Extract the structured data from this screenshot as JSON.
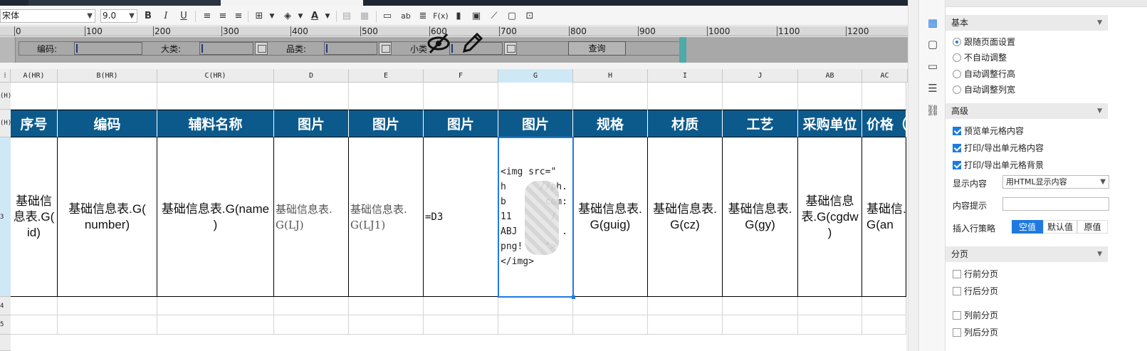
{
  "toolbar": {
    "font_name": "宋体",
    "font_size": "9.0",
    "bold": "B",
    "italic": "I",
    "underline": "U",
    "text_label": "ab",
    "fx_label": "F(x)"
  },
  "ruler": {
    "ticks": [
      "0",
      "100",
      "200",
      "300",
      "400",
      "500",
      "600",
      "700",
      "800",
      "900",
      "1000",
      "1100",
      "1200"
    ]
  },
  "params": {
    "code_label": "编码:",
    "category_label": "大类:",
    "type_label": "品类:",
    "subcategory_label": "小类",
    "query_button": "查询"
  },
  "columns": [
    "A(HR)",
    "B(HR)",
    "C(HR)",
    "D",
    "E",
    "F",
    "G",
    "H",
    "I",
    "J",
    "AB",
    "AC"
  ],
  "rows": [
    "(H)",
    "(H)",
    "3",
    "4",
    "5"
  ],
  "header_row": [
    "序号",
    "编码",
    "辅料名称",
    "图片",
    "图片",
    "图片",
    "图片",
    "规格",
    "材质",
    "工艺",
    "采购单位",
    "价格（"
  ],
  "data_row": {
    "a": "基础信\n息表.G(\nid)",
    "b": "基础信息表.G(\nnumber)",
    "c": "基础信息表.G(name\n)",
    "d": "基础信息表.\nG(LJ)",
    "e": "基础信息表.\nG(LJ1)",
    "f": "=D3",
    "g": "<img src=\"\nh      //ph.\nb       com:\n11       /\nABJ        .\npng!    \">\n</img>",
    "h": "基础信息表.\nG(guig)",
    "i": "基础信息表.\nG(cz)",
    "j": "基础信息表.\nG(gy)",
    "ab": "基础信息\n表.G(cgdw\n)",
    "ac": "基础信.\nG(an"
  },
  "panel": {
    "basic_title": "基本",
    "fit_options": [
      "跟随页面设置",
      "不自动调整",
      "自动调整行高",
      "自动调整列宽"
    ],
    "advanced_title": "高级",
    "adv_options": [
      "预览单元格内容",
      "打印/导出单元格内容",
      "打印/导出单元格背景"
    ],
    "display_label": "显示内容",
    "display_value": "用HTML显示内容",
    "tooltip_label": "内容提示",
    "tooltip_value": "",
    "insert_label": "插入行策略",
    "insert_options": [
      "空值",
      "默认值",
      "原值"
    ],
    "paging_title": "分页",
    "paging_options": [
      "行前分页",
      "行后分页",
      "列前分页",
      "列后分页"
    ]
  },
  "colors": {
    "header_bg": "#0c5a8c",
    "accent": "#1f7ae0",
    "param_bg": "#a8a8a8"
  }
}
